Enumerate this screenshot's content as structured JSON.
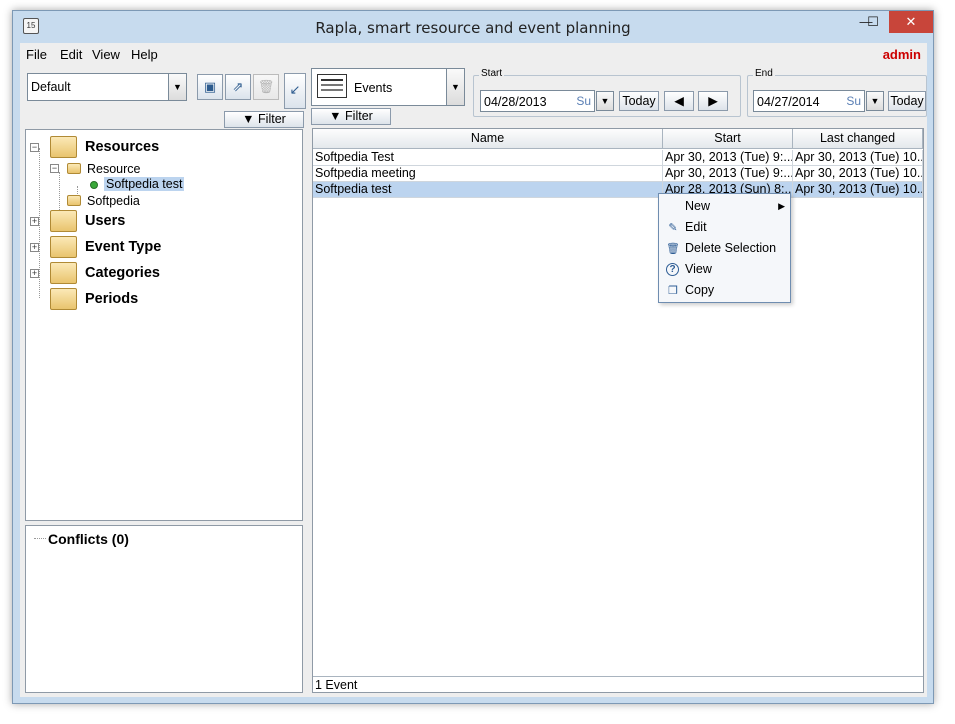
{
  "window": {
    "title": "Rapla, smart resource and event planning",
    "app_icon_text": "15",
    "minimize_glyph": "—",
    "maximize_glyph": "☐",
    "close_glyph": "✕"
  },
  "menubar": {
    "items": [
      "File",
      "Edit",
      "View",
      "Help"
    ],
    "user": "admin"
  },
  "left": {
    "perspective": "Default",
    "save_icon": "floppy-icon",
    "export_icon": "export-icon",
    "delete_icon": "trash-icon",
    "filter_label": "Filter",
    "tree": {
      "resources": "Resources",
      "resource_type": "Resource",
      "resource_item": "Softpedia test",
      "softpedia": "Softpedia",
      "users": "Users",
      "event_type": "Event Type",
      "categories": "Categories",
      "periods": "Periods"
    },
    "conflicts": "Conflicts (0)"
  },
  "right": {
    "view_label": "Events",
    "filter_label": "Filter",
    "start": {
      "label": "Start",
      "date": "04/28/2013",
      "day": "Su",
      "today": "Today"
    },
    "end": {
      "label": "End",
      "date": "04/27/2014",
      "day": "Su",
      "today": "Today"
    },
    "table": {
      "columns": [
        "Name",
        "Start",
        "Last changed"
      ],
      "rows": [
        {
          "name": "Softpedia Test",
          "start": "Apr 30, 2013 (Tue) 9:...",
          "changed": "Apr 30, 2013 (Tue) 10..."
        },
        {
          "name": "Softpedia meeting",
          "start": "Apr 30, 2013 (Tue) 9:...",
          "changed": "Apr 30, 2013 (Tue) 10..."
        },
        {
          "name": "Softpedia test",
          "start": "Apr 28, 2013 (Sun) 8:...",
          "changed": "Apr 30, 2013 (Tue) 10..."
        }
      ]
    },
    "status": "1 Event"
  },
  "context_menu": {
    "items": [
      {
        "label": "New",
        "icon": "",
        "submenu": true
      },
      {
        "label": "Edit",
        "icon": "edit-icon"
      },
      {
        "label": "Delete Selection",
        "icon": "trash-icon"
      },
      {
        "label": "View",
        "icon": "help-icon"
      },
      {
        "label": "Copy",
        "icon": "copy-icon"
      }
    ]
  }
}
